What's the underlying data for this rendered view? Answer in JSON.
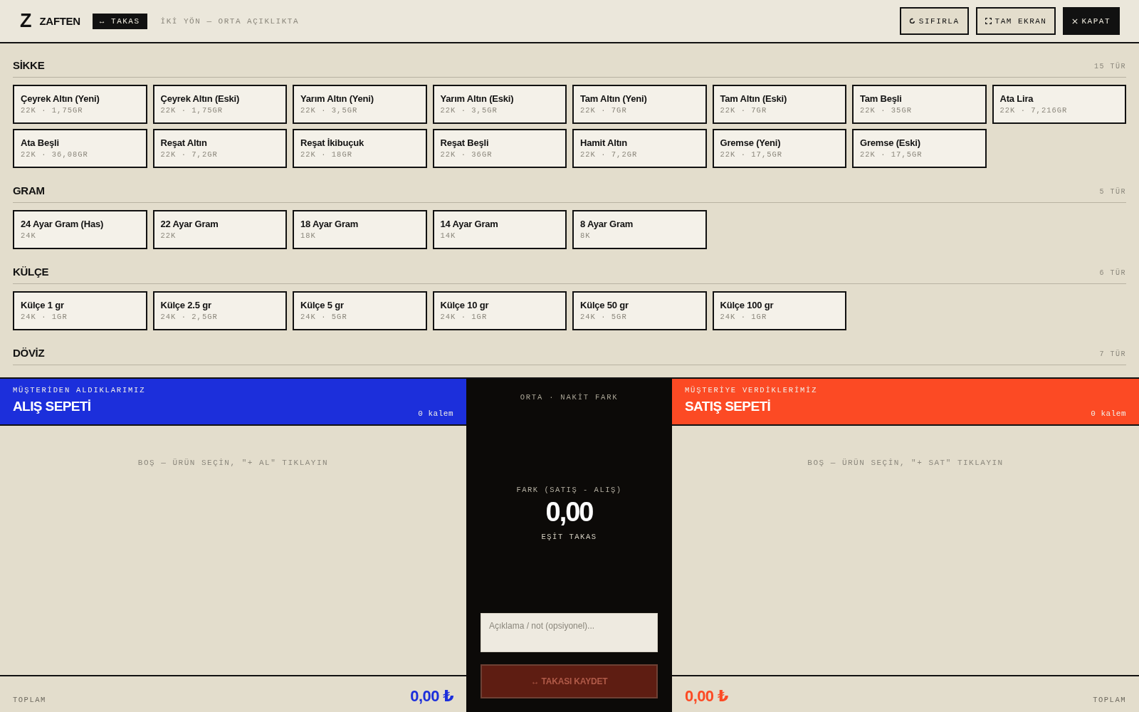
{
  "header": {
    "logo_mark": "Z",
    "brand": "ZAFTEN",
    "mode_badge": "↔ TAKAS",
    "subtitle": "İKİ YÖN — ORTA AÇIKLIKTA",
    "buttons": [
      {
        "label": "SIFIRLA",
        "kind": "outline"
      },
      {
        "label": "TAM EKRAN",
        "kind": "outline"
      },
      {
        "label": "KAPAT",
        "kind": "solid"
      }
    ]
  },
  "catalog": {
    "sections": [
      {
        "title": "SİKKE",
        "count": "15 TÜR",
        "cards": [
          {
            "name": "Çeyrek Altın (Yeni)",
            "detail": "22K · 1,75GR"
          },
          {
            "name": "Çeyrek Altın (Eski)",
            "detail": "22K · 1,75GR"
          },
          {
            "name": "Yarım Altın (Yeni)",
            "detail": "22K · 3,5GR"
          },
          {
            "name": "Yarım Altın (Eski)",
            "detail": "22K · 3,5GR"
          },
          {
            "name": "Tam Altın (Yeni)",
            "detail": "22K · 7GR"
          },
          {
            "name": "Tam Altın (Eski)",
            "detail": "22K · 7GR"
          },
          {
            "name": "Tam Beşli",
            "detail": "22K · 35GR"
          },
          {
            "name": "Ata Lira",
            "detail": "22K · 7,216GR"
          },
          {
            "name": "Ata Beşli",
            "detail": "22K · 36,08GR"
          },
          {
            "name": "Reşat Altın",
            "detail": "22K · 7,2GR"
          },
          {
            "name": "Reşat İkibuçuk",
            "detail": "22K · 18GR"
          },
          {
            "name": "Reşat Beşli",
            "detail": "22K · 36GR"
          },
          {
            "name": "Hamit Altın",
            "detail": "22K · 7,2GR"
          },
          {
            "name": "Gremse (Yeni)",
            "detail": "22K · 17,5GR"
          },
          {
            "name": "Gremse (Eski)",
            "detail": "22K · 17,5GR"
          }
        ]
      },
      {
        "title": "GRAM",
        "count": "5 TÜR",
        "cards": [
          {
            "name": "24 Ayar Gram (Has)",
            "detail": "24K"
          },
          {
            "name": "22 Ayar Gram",
            "detail": "22K"
          },
          {
            "name": "18 Ayar Gram",
            "detail": "18K"
          },
          {
            "name": "14 Ayar Gram",
            "detail": "14K"
          },
          {
            "name": "8 Ayar Gram",
            "detail": "8K"
          }
        ]
      },
      {
        "title": "KÜLÇE",
        "count": "6 TÜR",
        "cards": [
          {
            "name": "Külçe 1 gr",
            "detail": "24K · 1GR"
          },
          {
            "name": "Külçe 2.5 gr",
            "detail": "24K · 2,5GR"
          },
          {
            "name": "Külçe 5 gr",
            "detail": "24K · 5GR"
          },
          {
            "name": "Külçe 10 gr",
            "detail": "24K · 1GR"
          },
          {
            "name": "Külçe 50 gr",
            "detail": "24K · 5GR"
          },
          {
            "name": "Külçe 100 gr",
            "detail": "24K · 1GR"
          }
        ]
      },
      {
        "title": "DÖVİZ",
        "count": "7 TÜR"
      }
    ]
  },
  "buy_basket": {
    "kind": "buy",
    "eyebrow": "MÜŞTERİDEN ALDIKLARIMIZ",
    "title": "ALIŞ SEPETİ",
    "item_count": "0 kalem",
    "empty_message": "BOŞ — ÜRÜN SEÇİN, \"+ AL\" TIKLAYIN",
    "total_label": "TOPLAM",
    "total": "0,00 ₺"
  },
  "center": {
    "eyebrow": "ORTA · NAKİT FARK",
    "difference_label": "FARK (SATIŞ - ALIŞ)",
    "difference": "0,00",
    "status": "EŞİT TAKAS",
    "note": {
      "placeholder": "Açıklama / not (opsiyonel)..."
    },
    "save_button": {
      "label": "↔ TAKASI KAYDET",
      "disabled": true
    }
  },
  "sell_basket": {
    "kind": "sell",
    "eyebrow": "MÜŞTERİYE VERDİKLERİMİZ",
    "title": "SATIŞ SEPETİ",
    "item_count": "0 kalem",
    "empty_message": "BOŞ — ÜRÜN SEÇİN, \"+ SAT\" TIKLAYIN",
    "total_label": "TOPLAM",
    "total": "0,00 ₺"
  }
}
